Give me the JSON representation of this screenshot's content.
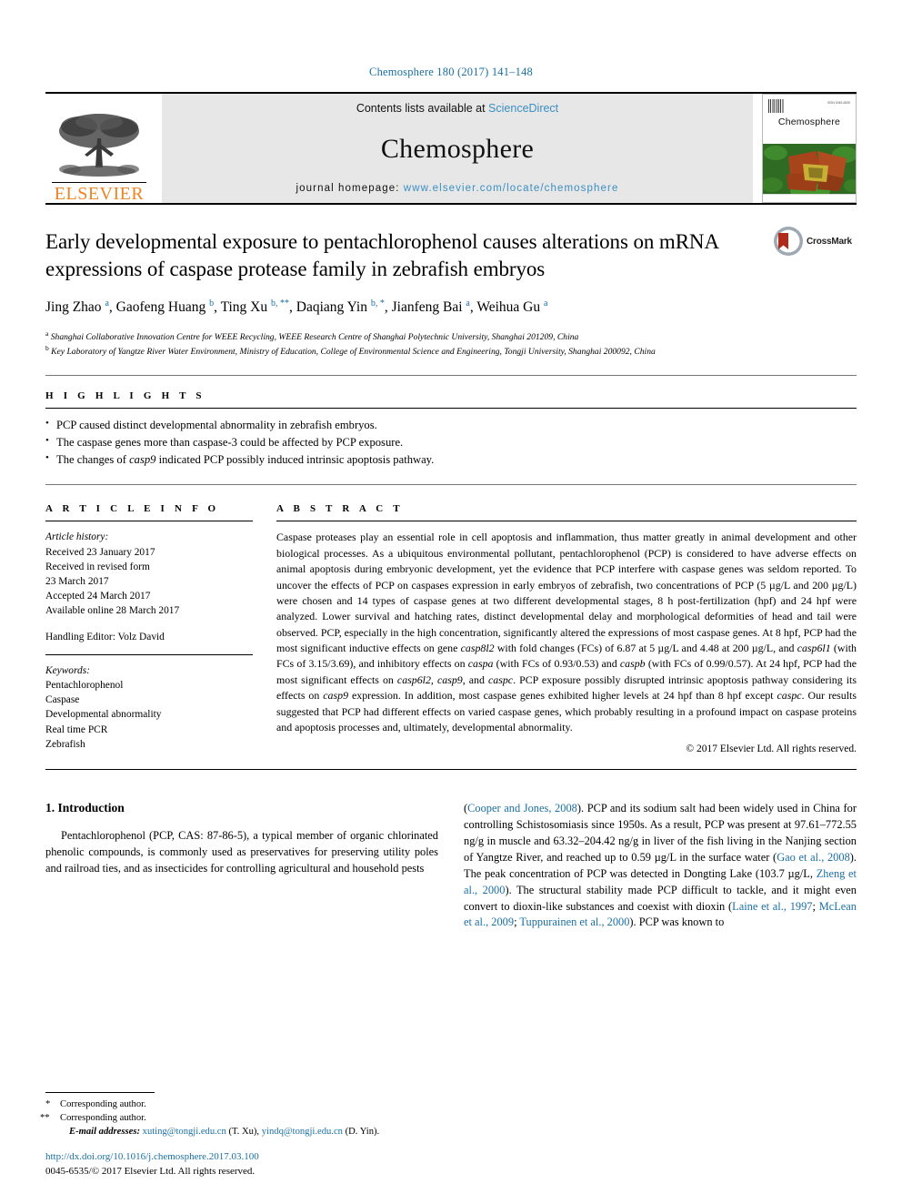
{
  "running_head": "Chemosphere 180 (2017) 141–148",
  "masthead": {
    "publisher_name": "ELSEVIER",
    "contents_prefix": "Contents lists available at ",
    "contents_link": "ScienceDirect",
    "journal_title": "Chemosphere",
    "homepage_prefix": "journal homepage: ",
    "homepage_url": "www.elsevier.com/locate/chemosphere",
    "cover_journal_name": "Chemosphere",
    "cover_tiny_text": "ISSN 0045-6535"
  },
  "crossmark": {
    "label": "CrossMark"
  },
  "article": {
    "title": "Early developmental exposure to pentachlorophenol causes alterations on mRNA expressions of caspase protease family in zebrafish embryos",
    "authors": [
      {
        "name": "Jing Zhao",
        "sup": "a",
        "sep": ", "
      },
      {
        "name": "Gaofeng Huang",
        "sup": "b",
        "sep": ", "
      },
      {
        "name": "Ting Xu",
        "sup": "b, **",
        "sep": ", "
      },
      {
        "name": "Daqiang Yin",
        "sup": "b, *",
        "sep": ", "
      },
      {
        "name": "Jianfeng Bai",
        "sup": "a",
        "sep": ", "
      },
      {
        "name": "Weihua Gu",
        "sup": "a",
        "sep": ""
      }
    ],
    "affiliations": [
      {
        "mark": "a",
        "text": "Shanghai Collaborative Innovation Centre for WEEE Recycling, WEEE Research Centre of Shanghai Polytechnic University, Shanghai 201209, China"
      },
      {
        "mark": "b",
        "text": "Key Laboratory of Yangtze River Water Environment, Ministry of Education, College of Environmental Science and Engineering, Tongji University, Shanghai 200092, China"
      }
    ]
  },
  "highlights": {
    "heading": "H I G H L I G H T S",
    "items": [
      "PCP caused distinct developmental abnormality in zebrafish embryos.",
      "The caspase genes more than caspase-3 could be affected by PCP exposure.",
      "The changes of casp9 indicated PCP possibly induced intrinsic apoptosis pathway."
    ]
  },
  "article_info": {
    "heading": "A R T I C L E   I N F O",
    "history_label": "Article history:",
    "history": [
      "Received 23 January 2017",
      "Received in revised form",
      "23 March 2017",
      "Accepted 24 March 2017",
      "Available online 28 March 2017"
    ],
    "handling_editor": "Handling Editor: Volz David",
    "keywords_label": "Keywords:",
    "keywords": [
      "Pentachlorophenol",
      "Caspase",
      "Developmental abnormality",
      "Real time PCR",
      "Zebrafish"
    ]
  },
  "abstract": {
    "heading": "A B S T R A C T",
    "text": "Caspase proteases play an essential role in cell apoptosis and inflammation, thus matter greatly in animal development and other biological processes. As a ubiquitous environmental pollutant, pentachlorophenol (PCP) is considered to have adverse effects on animal apoptosis during embryonic development, yet the evidence that PCP interfere with caspase genes was seldom reported. To uncover the effects of PCP on caspases expression in early embryos of zebrafish, two concentrations of PCP (5 µg/L and 200 µg/L) were chosen and 14 types of caspase genes at two different developmental stages, 8 h post-fertilization (hpf) and 24 hpf were analyzed. Lower survival and hatching rates, distinct developmental delay and morphological deformities of head and tail were observed. PCP, especially in the high concentration, significantly altered the expressions of most caspase genes. At 8 hpf, PCP had the most significant inductive effects on gene casp8l2 with fold changes (FCs) of 6.87 at 5 µg/L and 4.48 at 200 µg/L, and casp6l1 (with FCs of 3.15/3.69), and inhibitory effects on caspa (with FCs of 0.93/0.53) and caspb (with FCs of 0.99/0.57). At 24 hpf, PCP had the most significant effects on casp6l2, casp9, and caspc. PCP exposure possibly disrupted intrinsic apoptosis pathway considering its effects on casp9 expression. In addition, most caspase genes exhibited higher levels at 24 hpf than 8 hpf except caspc. Our results suggested that PCP had different effects on varied caspase genes, which probably resulting in a profound impact on caspase proteins and apoptosis processes and, ultimately, developmental abnormality.",
    "copyright": "© 2017 Elsevier Ltd. All rights reserved."
  },
  "introduction": {
    "section_number_title": "1. Introduction",
    "left_paragraph": "Pentachlorophenol (PCP, CAS: 87-86-5), a typical member of organic chlorinated phenolic compounds, is commonly used as preservatives for preserving utility poles and railroad ties, and as insecticides for controlling agricultural and household pests",
    "right_paragraph": "(Cooper and Jones, 2008). PCP and its sodium salt had been widely used in China for controlling Schistosomiasis since 1950s. As a result, PCP was present at 97.61–772.55 ng/g in muscle and 63.32–204.42 ng/g in liver of the fish living in the Nanjing section of Yangtze River, and reached up to 0.59 µg/L in the surface water (Gao et al., 2008). The peak concentration of PCP was detected in Dongting Lake (103.7 µg/L, Zheng et al., 2000). The structural stability made PCP difficult to tackle, and it might even convert to dioxin-like substances and coexist with dioxin (Laine et al., 1997; McLean et al., 2009; Tuppurainen et al., 2000). PCP was known to"
  },
  "footnotes": {
    "corresponding_single": "Corresponding author.",
    "corresponding_double": "Corresponding author.",
    "email_label": "E-mail addresses:",
    "email_1": "xuting@tongji.edu.cn",
    "email_1_who": "(T. Xu),",
    "email_2": "yindq@tongji.edu.cn",
    "email_2_who": "(D. Yin).",
    "doi": "http://dx.doi.org/10.1016/j.chemosphere.2017.03.100",
    "issn_line": "0045-6535/© 2017 Elsevier Ltd. All rights reserved."
  },
  "colors": {
    "link_blue": "#1a6fa3",
    "sciencedirect_blue": "#3a8fc4",
    "elsevier_orange": "#ee8424",
    "band_gray": "#e7e7e7"
  }
}
